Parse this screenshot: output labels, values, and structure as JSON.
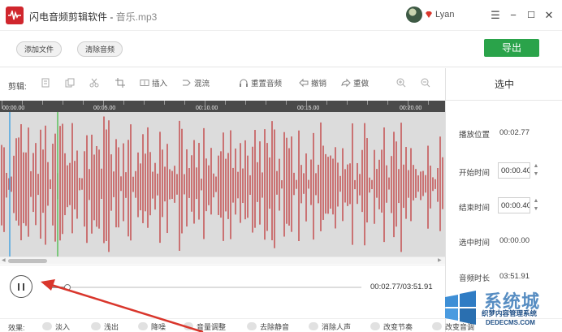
{
  "window": {
    "app_name": "闪电音频剪辑软件 - ",
    "file_name": "音乐.mp3",
    "username": "Lyan",
    "minimize": "−",
    "maximize": "☐",
    "close": "✕",
    "menu": "☰"
  },
  "toolbar": {
    "add_file": "添加文件",
    "clear_audio": "清除音频",
    "export": "导出"
  },
  "edit_toolbar": {
    "label": "剪辑:",
    "tools": [
      {
        "name": "copy",
        "label": ""
      },
      {
        "name": "paste",
        "label": ""
      },
      {
        "name": "cut",
        "label": ""
      },
      {
        "name": "crop",
        "label": ""
      },
      {
        "name": "insert",
        "label": "插入"
      },
      {
        "name": "mix",
        "label": "混流"
      },
      {
        "name": "rerecord",
        "label": "重置音频"
      },
      {
        "name": "undo",
        "label": "撤销"
      },
      {
        "name": "redo",
        "label": "重做"
      },
      {
        "name": "zoom-in",
        "label": ""
      },
      {
        "name": "zoom-out",
        "label": ""
      }
    ]
  },
  "ruler": {
    "ticks": [
      "00:00.00",
      "00:05.00",
      "00:10.00",
      "00:15.00",
      "00:20.00"
    ]
  },
  "selection_panel": {
    "title": "选中",
    "play_position_label": "播放位置",
    "play_position_value": "00:02.77",
    "start_time_label": "开始时间",
    "start_time_value": "00:00.40",
    "end_time_label": "结束时间",
    "end_time_value": "00:00.40",
    "selected_time_label": "选中时间",
    "selected_time_value": "00:00.00",
    "duration_label": "音频时长",
    "duration_value": "03:51.91"
  },
  "playback": {
    "time_readout": "00:02.77/03:51.91",
    "progress": 0.012
  },
  "effects": {
    "label": "效果:",
    "items": [
      "淡入",
      "浅出",
      "降噪",
      "音量调整",
      "去除静音",
      "消除人声",
      "改变节奏",
      "改变音调"
    ]
  },
  "watermark": {
    "big": "系统城",
    "cn": "织梦内容管理系统",
    "url": "DEDECMS.COM"
  },
  "colors": {
    "brand_red": "#d0262d",
    "export_green": "#2aa34a",
    "wave_red": "#c0393b",
    "wave_bg": "#dcdcdc",
    "ruler_bg": "#4a4a4a",
    "cursor_blue": "#4aa3e0",
    "playhead_green": "#5cc05c",
    "arrow_red": "#d9362c"
  }
}
